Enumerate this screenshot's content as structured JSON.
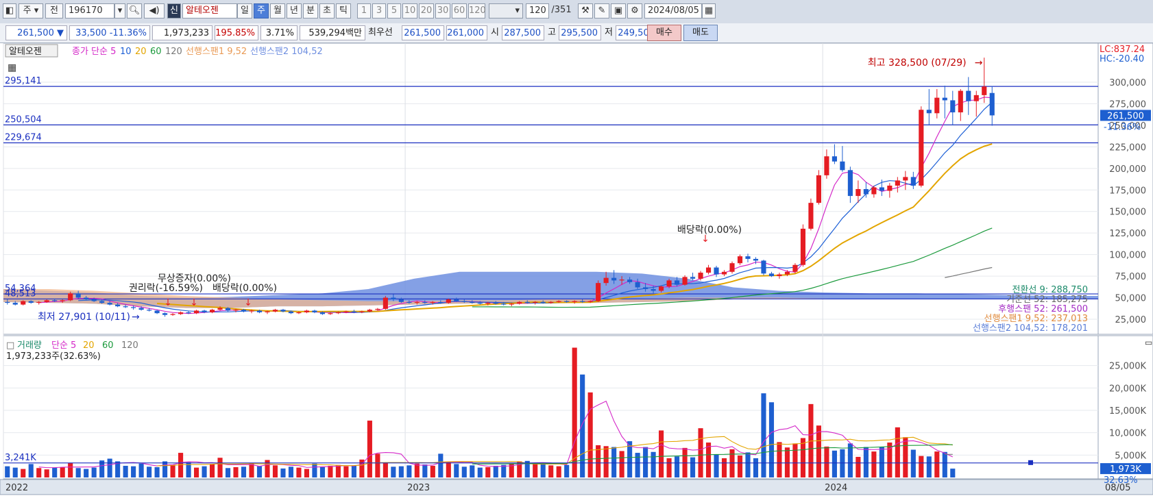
{
  "toolbar": {
    "period_select": "주",
    "prev_label": "전",
    "code": "196170",
    "sin_badge": "신",
    "stock_name": "알테오젠",
    "period_tabs": [
      "일",
      "주",
      "월",
      "년",
      "분",
      "초",
      "틱"
    ],
    "active_tab": "주",
    "minute_buttons": [
      "1",
      "3",
      "5",
      "10",
      "20",
      "30",
      "60",
      "120"
    ],
    "count_value": "120",
    "count_total": "/351",
    "date_value": "2024/08/05"
  },
  "quote": {
    "price": "261,500",
    "change": "33,500",
    "change_pct": "-11.36%",
    "volume": "1,973,233",
    "volume_ratio": "195.85%",
    "turnover": "3.71%",
    "trade_value": "539,294백만",
    "best_label": "최우선",
    "best_ask": "261,500",
    "best_bid": "261,000",
    "open_label": "시",
    "open": "287,500",
    "high_label": "고",
    "high": "295,500",
    "low_label": "저",
    "low": "249,500",
    "buy_label": "매수",
    "sell_label": "매도"
  },
  "price_panel": {
    "legend_name": "알테오젠",
    "legend_items": [
      {
        "text": "종가 단순 5",
        "color": "#d428c8"
      },
      {
        "text": "10",
        "color": "#1c5fd6"
      },
      {
        "text": "20",
        "color": "#e3a500"
      },
      {
        "text": "60",
        "color": "#1b9a3c"
      },
      {
        "text": "120",
        "color": "#777777"
      },
      {
        "text": "선행스팬1 9,52",
        "color": "#e99a55"
      },
      {
        "text": "선행스팬2 104,52",
        "color": "#6f8fe0"
      }
    ],
    "lc_label": "LC:837.24",
    "hc_label": "HC:-20.40",
    "hlines": [
      {
        "label": "295,141",
        "value": 295141
      },
      {
        "label": "250,504",
        "value": 250504
      },
      {
        "label": "229,674",
        "value": 229674
      },
      {
        "label": "54,364",
        "value": 54364
      },
      {
        "label": "48,513",
        "value": 48513
      }
    ],
    "y_ticks": [
      "300,000",
      "275,000",
      "250,000",
      "225,000",
      "200,000",
      "175,000",
      "150,000",
      "125,000",
      "100,000",
      "75,000",
      "50,000",
      "25,000"
    ],
    "price_badge": "261,500",
    "price_pct": "-11.36%",
    "max_annot": "최고 328,500 (07/29)",
    "min_annot": "최저 27,901 (10/11)",
    "event_labels": [
      "배당락(0.00%)",
      "무상증자(0.00%)",
      "권리락(-16.59%)",
      "배당락(0.00%)"
    ],
    "ichimoku": [
      {
        "text": "전환선 9: 288,750",
        "color": "#1b8a6a"
      },
      {
        "text": "기준선 52: 185,275",
        "color": "#666666"
      },
      {
        "text": "후행스팬 52: 261,500",
        "color": "#a32cc4"
      },
      {
        "text": "선행스팬1 9,52: 237,013",
        "color": "#e08a3c"
      },
      {
        "text": "선행스팬2 104,52: 178,201",
        "color": "#5b7fd8"
      }
    ]
  },
  "volume_panel": {
    "legend_name": "거래량",
    "legend_items": [
      {
        "text": "단순 5",
        "color": "#d428c8"
      },
      {
        "text": "20",
        "color": "#e3a500"
      },
      {
        "text": "60",
        "color": "#1b9a3c"
      },
      {
        "text": "120",
        "color": "#777777"
      }
    ],
    "current": "1,973,233주(32.63%)",
    "hline_label": "3,241K",
    "y_ticks": [
      "25,000K",
      "20,000K",
      "15,000K",
      "10,000K",
      "5,000K"
    ],
    "badge": "1,973K",
    "badge_pct": "32.63%"
  },
  "x_axis": {
    "labels": [
      "2022",
      "2023",
      "2024"
    ],
    "last_date": "08/05"
  },
  "chart_data": {
    "type": "candlestick",
    "title": "알테오젠",
    "interval": "weekly",
    "ylim": [
      10000,
      345000
    ],
    "vol_ylim": [
      0,
      30000
    ],
    "candles": [
      [
        45000,
        48000,
        42000,
        44000
      ],
      [
        44000,
        46000,
        41000,
        42000
      ],
      [
        42000,
        47000,
        41000,
        46000
      ],
      [
        46000,
        47000,
        43000,
        44000
      ],
      [
        44000,
        46000,
        42000,
        45000
      ],
      [
        45000,
        48000,
        44000,
        47000
      ],
      [
        47000,
        49000,
        45000,
        46000
      ],
      [
        46000,
        48000,
        44000,
        47000
      ],
      [
        47000,
        57000,
        46000,
        55000
      ],
      [
        55000,
        58000,
        49000,
        50000
      ],
      [
        50000,
        52000,
        47000,
        48000
      ],
      [
        48000,
        50000,
        45000,
        46000
      ],
      [
        46000,
        48000,
        43000,
        44000
      ],
      [
        44000,
        46000,
        41000,
        42000
      ],
      [
        42000,
        44000,
        39000,
        40000
      ],
      [
        40000,
        42000,
        38000,
        39000
      ],
      [
        39000,
        41000,
        36000,
        38000
      ],
      [
        38000,
        40000,
        35000,
        36000
      ],
      [
        36000,
        38000,
        34000,
        35000
      ],
      [
        35000,
        36000,
        31000,
        32000
      ],
      [
        32000,
        33000,
        27901,
        30000
      ],
      [
        30000,
        32000,
        29000,
        31000
      ],
      [
        31000,
        34000,
        30000,
        33000
      ],
      [
        33000,
        35000,
        31000,
        32000
      ],
      [
        32000,
        36000,
        31000,
        35000
      ],
      [
        35000,
        36000,
        32000,
        33000
      ],
      [
        33000,
        37000,
        32000,
        36000
      ],
      [
        36000,
        40000,
        35000,
        38000
      ],
      [
        38000,
        39000,
        34000,
        35000
      ],
      [
        35000,
        37000,
        33000,
        36000
      ],
      [
        36000,
        37000,
        33000,
        34000
      ],
      [
        34000,
        36000,
        32000,
        35000
      ],
      [
        35000,
        36000,
        32000,
        33000
      ],
      [
        33000,
        35000,
        31000,
        34000
      ],
      [
        34000,
        37000,
        33000,
        36000
      ],
      [
        36000,
        37000,
        33000,
        34000
      ],
      [
        34000,
        35000,
        31000,
        32000
      ],
      [
        32000,
        34000,
        31000,
        33000
      ],
      [
        33000,
        36000,
        32000,
        35000
      ],
      [
        35000,
        36000,
        32000,
        33000
      ],
      [
        33000,
        34000,
        30000,
        31000
      ],
      [
        31000,
        33000,
        30000,
        32000
      ],
      [
        32000,
        34000,
        31000,
        33000
      ],
      [
        33000,
        35000,
        32000,
        34000
      ],
      [
        34000,
        36000,
        32000,
        33000
      ],
      [
        33000,
        35000,
        32000,
        34000
      ],
      [
        34000,
        37000,
        33000,
        36000
      ],
      [
        36000,
        38000,
        35000,
        37000
      ],
      [
        37000,
        52000,
        36000,
        50000
      ],
      [
        50000,
        54000,
        46000,
        48000
      ],
      [
        48000,
        50000,
        44000,
        45000
      ],
      [
        45000,
        47000,
        43000,
        44000
      ],
      [
        44000,
        46000,
        42000,
        45000
      ],
      [
        45000,
        47000,
        43000,
        44000
      ],
      [
        44000,
        46000,
        42000,
        45000
      ],
      [
        45000,
        47000,
        43000,
        44000
      ],
      [
        44000,
        49000,
        43000,
        48000
      ],
      [
        48000,
        50000,
        45000,
        46000
      ],
      [
        46000,
        48000,
        44000,
        45000
      ],
      [
        45000,
        47000,
        43000,
        44000
      ],
      [
        44000,
        46000,
        42000,
        43000
      ],
      [
        43000,
        45000,
        41000,
        44000
      ],
      [
        44000,
        46000,
        42000,
        43000
      ],
      [
        43000,
        45000,
        41000,
        42000
      ],
      [
        42000,
        44000,
        40000,
        43000
      ],
      [
        43000,
        46000,
        42000,
        45000
      ],
      [
        45000,
        47000,
        43000,
        44000
      ],
      [
        44000,
        46000,
        42000,
        45000
      ],
      [
        45000,
        47000,
        43000,
        44000
      ],
      [
        44000,
        46000,
        43000,
        45000
      ],
      [
        45000,
        47000,
        44000,
        46000
      ],
      [
        46000,
        47000,
        44000,
        45000
      ],
      [
        45000,
        47000,
        43000,
        46000
      ],
      [
        46000,
        48000,
        44000,
        45000
      ],
      [
        45000,
        47000,
        44000,
        46000
      ],
      [
        46000,
        70000,
        45000,
        67000
      ],
      [
        67000,
        80000,
        64000,
        73000
      ],
      [
        73000,
        82000,
        66000,
        70000
      ],
      [
        70000,
        75000,
        65000,
        71000
      ],
      [
        71000,
        74000,
        66000,
        68000
      ],
      [
        68000,
        72000,
        60000,
        62000
      ],
      [
        62000,
        67000,
        57000,
        60000
      ],
      [
        60000,
        64000,
        55000,
        58000
      ],
      [
        58000,
        64000,
        56000,
        63000
      ],
      [
        63000,
        72000,
        61000,
        70000
      ],
      [
        70000,
        74000,
        63000,
        65000
      ],
      [
        65000,
        76000,
        64000,
        74000
      ],
      [
        74000,
        79000,
        70000,
        72000
      ],
      [
        72000,
        81000,
        70000,
        79000
      ],
      [
        79000,
        88000,
        77000,
        85000
      ],
      [
        85000,
        87000,
        74000,
        77000
      ],
      [
        77000,
        82000,
        75000,
        80000
      ],
      [
        80000,
        92000,
        78000,
        90000
      ],
      [
        90000,
        100000,
        88000,
        98000
      ],
      [
        98000,
        101000,
        91000,
        95000
      ],
      [
        95000,
        97000,
        89000,
        93000
      ],
      [
        93000,
        94000,
        76000,
        78000
      ],
      [
        78000,
        80000,
        74000,
        75000
      ],
      [
        75000,
        79000,
        72000,
        77000
      ],
      [
        77000,
        82000,
        75000,
        80000
      ],
      [
        80000,
        90000,
        78000,
        88000
      ],
      [
        88000,
        135000,
        86000,
        130000
      ],
      [
        130000,
        165000,
        128000,
        160000
      ],
      [
        160000,
        198000,
        158000,
        192000
      ],
      [
        192000,
        222000,
        188000,
        214000
      ],
      [
        214000,
        228000,
        205000,
        208000
      ],
      [
        208000,
        226000,
        196000,
        198000
      ],
      [
        198000,
        202000,
        160000,
        168000
      ],
      [
        168000,
        186000,
        160000,
        176000
      ],
      [
        176000,
        184000,
        166000,
        170000
      ],
      [
        170000,
        180000,
        166000,
        178000
      ],
      [
        178000,
        187000,
        168000,
        174000
      ],
      [
        174000,
        183000,
        166000,
        180000
      ],
      [
        180000,
        190000,
        172000,
        186000
      ],
      [
        186000,
        197000,
        175000,
        190000
      ],
      [
        190000,
        196000,
        176000,
        180000
      ],
      [
        180000,
        272000,
        178000,
        268000
      ],
      [
        268000,
        292000,
        250000,
        264000
      ],
      [
        264000,
        292000,
        258000,
        282000
      ],
      [
        282000,
        296000,
        258000,
        279000
      ],
      [
        279000,
        290000,
        250000,
        265000
      ],
      [
        265000,
        292000,
        255000,
        290000
      ],
      [
        290000,
        306000,
        262000,
        278000
      ],
      [
        278000,
        290000,
        260000,
        285000
      ],
      [
        285000,
        328500,
        276000,
        295000
      ],
      [
        287500,
        295500,
        249500,
        261500
      ]
    ],
    "volume": [
      2500,
      2200,
      1900,
      3000,
      2100,
      1800,
      2200,
      2300,
      3200,
      2100,
      1900,
      2200,
      3800,
      4200,
      3600,
      2600,
      2500,
      3100,
      2400,
      2300,
      3600,
      2800,
      5500,
      3400,
      2200,
      2500,
      3000,
      4400,
      2100,
      2300,
      2400,
      3200,
      2500,
      3900,
      2700,
      2000,
      2400,
      2200,
      1900,
      3100,
      2300,
      2600,
      2800,
      2500,
      2700,
      4000,
      12700,
      5300,
      3200,
      2400,
      2500,
      2700,
      3100,
      2900,
      2600,
      5300,
      3400,
      3000,
      2400,
      2700,
      2200,
      2300,
      2600,
      2800,
      3100,
      3600,
      3700,
      3200,
      3000,
      2700,
      2500,
      2800,
      29000,
      23000,
      19000,
      7200,
      7000,
      6800,
      5900,
      8100,
      5500,
      6800,
      5700,
      10500,
      4300,
      4700,
      6600,
      4500,
      11000,
      7800,
      5100,
      4300,
      6300,
      4900,
      5600,
      4300,
      18800,
      16800,
      7900,
      6700,
      7600,
      8800,
      16400,
      11600,
      6900,
      6000,
      6300,
      7600,
      4600,
      6800,
      5800,
      6800,
      7800,
      11200,
      9000,
      6200,
      4800,
      4700,
      5800,
      5700,
      1973
    ],
    "ma5_vol_ref": "단순 5"
  }
}
